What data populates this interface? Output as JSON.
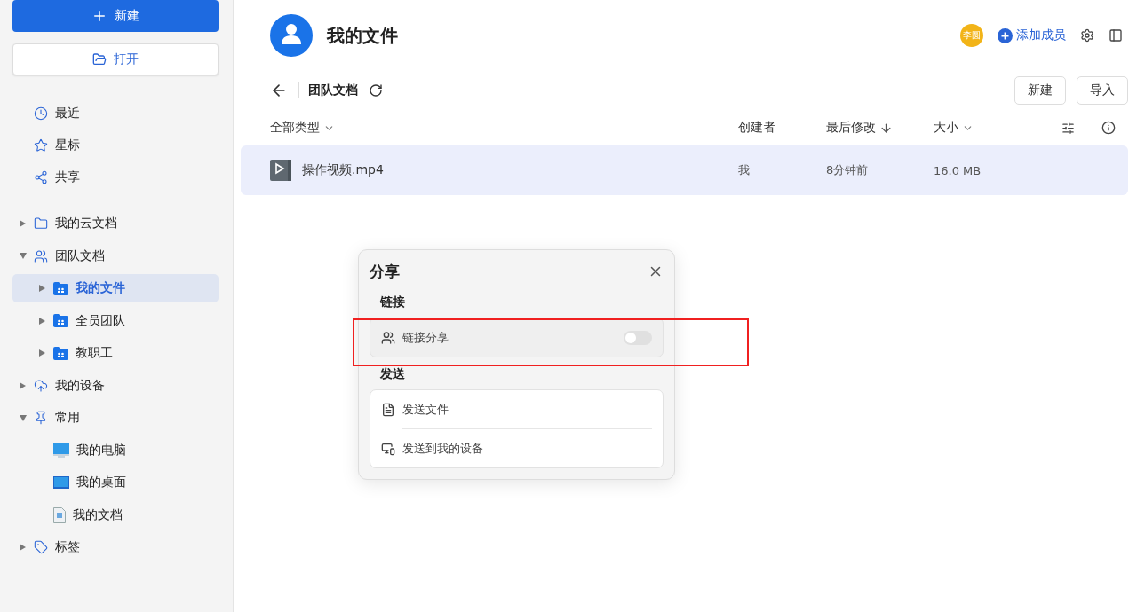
{
  "sidebar": {
    "new_button": "新建",
    "open_button": "打开",
    "quick": [
      {
        "label": "最近",
        "kind": "clock"
      },
      {
        "label": "星标",
        "kind": "star"
      },
      {
        "label": "共享",
        "kind": "share"
      }
    ],
    "tree": [
      {
        "label": "我的云文档",
        "kind": "folder",
        "expanded": false,
        "selected": false
      },
      {
        "label": "团队文档",
        "kind": "team",
        "expanded": true,
        "selected": false,
        "children": [
          {
            "label": "我的文件",
            "kind": "team-folder",
            "expanded": false,
            "selected": true
          },
          {
            "label": "全员团队",
            "kind": "team-folder",
            "expanded": false,
            "selected": false
          },
          {
            "label": "教职工",
            "kind": "team-folder",
            "expanded": false,
            "selected": false
          }
        ]
      },
      {
        "label": "我的设备",
        "kind": "cloud",
        "expanded": false,
        "selected": false
      },
      {
        "label": "常用",
        "kind": "pin",
        "expanded": true,
        "selected": false,
        "children": [
          {
            "label": "我的电脑",
            "kind": "computer",
            "selected": false
          },
          {
            "label": "我的桌面",
            "kind": "desktop",
            "selected": false
          },
          {
            "label": "我的文档",
            "kind": "document",
            "selected": false
          }
        ]
      },
      {
        "label": "标签",
        "kind": "tag",
        "expanded": false,
        "selected": false
      }
    ]
  },
  "header": {
    "title": "我的文件",
    "avatar": "李圆",
    "add_member": "添加成员"
  },
  "breadcrumb": "团队文档",
  "actions": [
    "新建",
    "导入"
  ],
  "table": {
    "columns": [
      {
        "label": "全部类型",
        "kind": "dropdown"
      },
      {
        "label": "创建者",
        "kind": "plain"
      },
      {
        "label": "最后修改",
        "kind": "sort"
      },
      {
        "label": "大小",
        "kind": "dropdown"
      }
    ],
    "rows": [
      {
        "name": "操作视频.mp4",
        "creator": "我",
        "modified": "8分钟前",
        "size": "16.0 MB",
        "selected": true
      }
    ]
  },
  "share_dialog": {
    "title": "分享",
    "sections": [
      {
        "heading": "链接",
        "items": [
          {
            "label": "链接分享",
            "kind": "toggle",
            "on": false
          }
        ]
      },
      {
        "heading": "发送",
        "items": [
          {
            "label": "发送文件",
            "kind": "file"
          },
          {
            "label": "发送到我的设备",
            "kind": "device"
          }
        ]
      }
    ]
  }
}
